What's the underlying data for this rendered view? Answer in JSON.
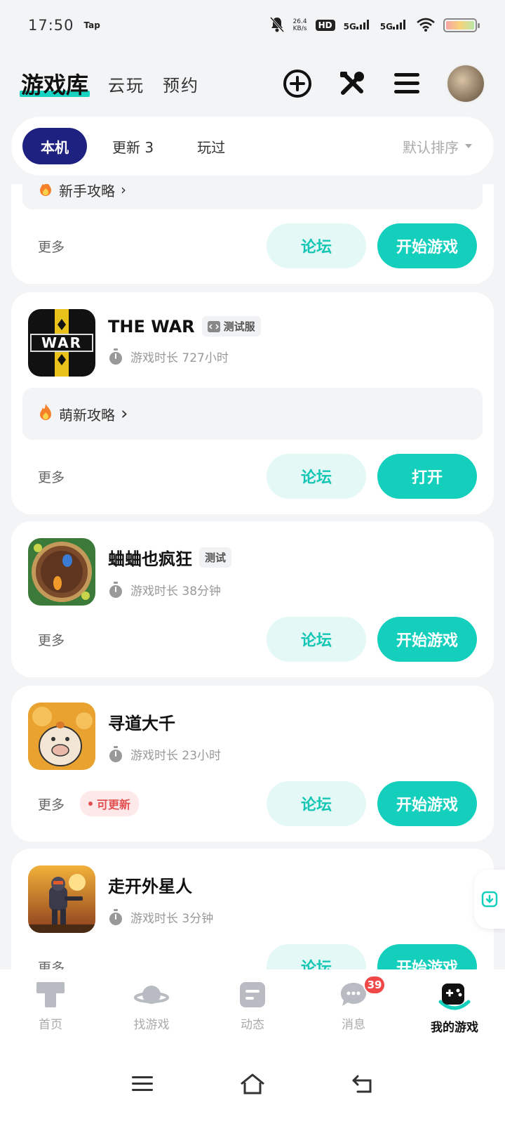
{
  "status_bar": {
    "time": "17:50",
    "app_tag": "Tap",
    "net_speed_value": "26.4",
    "net_speed_unit": "KB/s",
    "hd": "HD",
    "net1": "5G",
    "net2": "5G"
  },
  "header": {
    "brand": "游戏库",
    "nav_cloud": "云玩",
    "nav_reserve": "预约"
  },
  "filter": {
    "tabs": [
      "本机",
      "更新 3",
      "玩过"
    ],
    "sort_label": "默认排序"
  },
  "common": {
    "more": "更多",
    "forum": "论坛",
    "start_game": "开始游戏",
    "open": "打开",
    "can_update": "可更新"
  },
  "partial_card": {
    "tip": "新手攻略"
  },
  "games": [
    {
      "name": "THE WAR",
      "tag": "测试服",
      "playtime": "游戏时长 727小时",
      "tip": "萌新攻略",
      "primary": "打开"
    },
    {
      "name": "蛐蛐也疯狂",
      "tag": "测试",
      "playtime": "游戏时长 38分钟",
      "primary": "开始游戏"
    },
    {
      "name": "寻道大千",
      "playtime": "游戏时长 23小时",
      "primary": "开始游戏"
    },
    {
      "name": "走开外星人",
      "playtime": "游戏时长 3分钟",
      "primary": "开始游戏"
    }
  ],
  "tabbar": {
    "items": [
      "首页",
      "找游戏",
      "动态",
      "消息",
      "我的游戏"
    ],
    "message_count": "39"
  }
}
